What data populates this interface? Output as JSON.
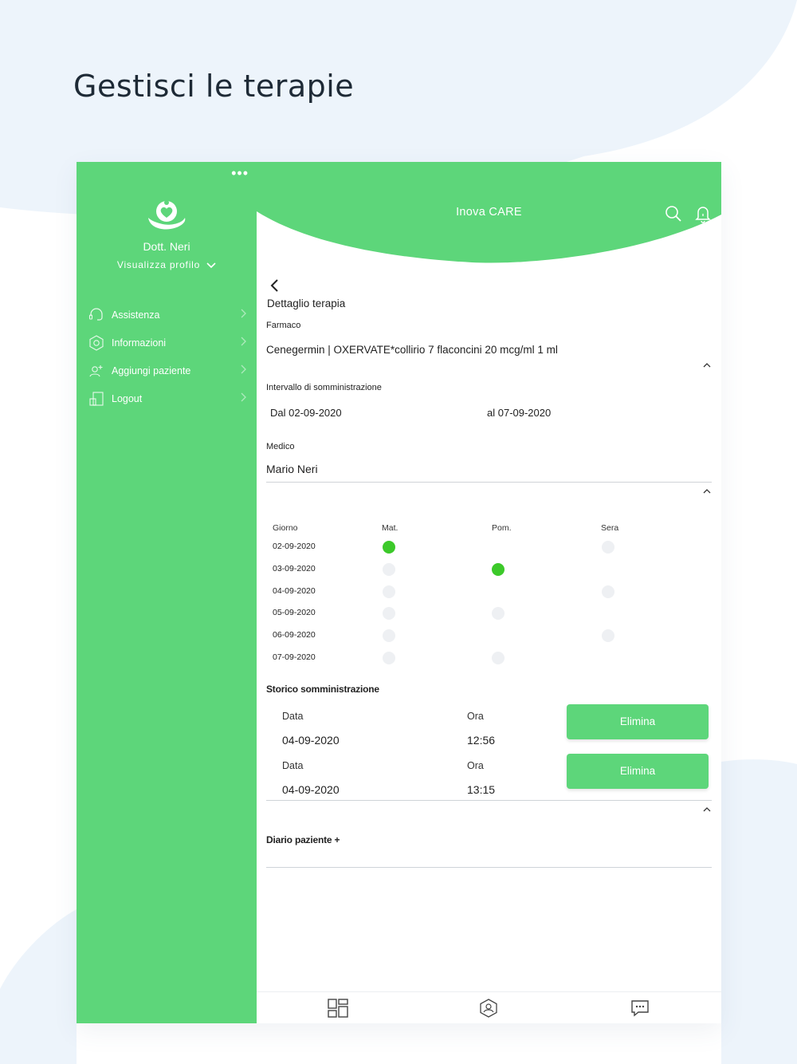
{
  "headline": "Gestisci le terapie",
  "sidebar": {
    "more": "•••",
    "doctor_name": "Dott. Neri",
    "profile_link": "Visualizza profilo",
    "items": [
      {
        "label": "Assistenza",
        "icon": "headset-icon"
      },
      {
        "label": "Informazioni",
        "icon": "info-hexagon-icon"
      },
      {
        "label": "Aggiungi paziente",
        "icon": "add-user-icon"
      },
      {
        "label": "Logout",
        "icon": "logout-icon"
      }
    ]
  },
  "header": {
    "title": "Inova CARE"
  },
  "detail": {
    "title": "Dettaglio terapia",
    "drug_label": "Farmaco",
    "drug_value": "Cenegermin | OXERVATE*collirio 7 flaconcini 20 mcg/ml 1 ml",
    "interval_label": "Intervallo di somministrazione",
    "from": "Dal 02-09-2020",
    "to": "al 07-09-2020",
    "doctor_label": "Medico",
    "doctor_value": "Mario Neri"
  },
  "schedule": {
    "headers": [
      "Giorno",
      "Mat.",
      "Pom.",
      "Sera"
    ],
    "rows": [
      {
        "date": "02-09-2020",
        "mat": "taken",
        "pom": "none",
        "sera": "pending"
      },
      {
        "date": "03-09-2020",
        "mat": "pending",
        "pom": "taken",
        "sera": "none"
      },
      {
        "date": "04-09-2020",
        "mat": "pending",
        "pom": "none",
        "sera": "pending"
      },
      {
        "date": "05-09-2020",
        "mat": "pending",
        "pom": "pending",
        "sera": "none"
      },
      {
        "date": "06-09-2020",
        "mat": "pending",
        "pom": "none",
        "sera": "pending"
      },
      {
        "date": "07-09-2020",
        "mat": "pending",
        "pom": "pending",
        "sera": "none"
      }
    ]
  },
  "history": {
    "title": "Storico somministrazione",
    "date_label": "Data",
    "time_label": "Ora",
    "button_label": "Elimina",
    "entries": [
      {
        "date": "04-09-2020",
        "time": "12:56"
      },
      {
        "date": "04-09-2020",
        "time": "13:15"
      }
    ]
  },
  "diary": {
    "title": "Diario paziente +"
  },
  "colors": {
    "accent": "#5dd67a",
    "taken": "#3cc92a",
    "pending": "#eef0f3",
    "background_shape": "#ecf4fc"
  }
}
